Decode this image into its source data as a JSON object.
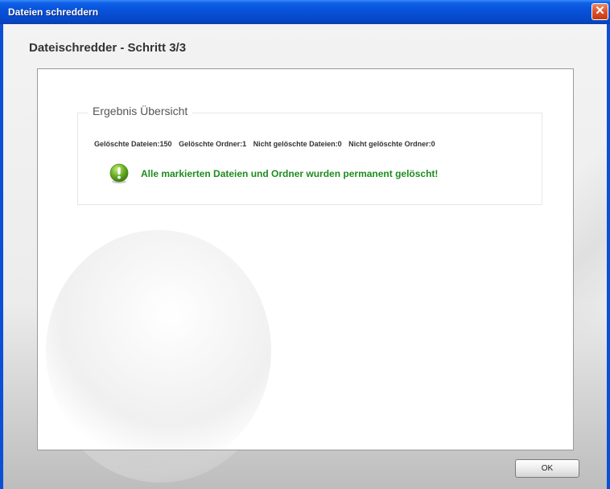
{
  "window": {
    "title": "Dateien schreddern"
  },
  "titlebar": {
    "close_glyph": "✕",
    "close_icon": "close-icon"
  },
  "page": {
    "title": "Dateischredder - Schritt 3/3"
  },
  "results": {
    "legend": "Ergebnis Übersicht",
    "stats": [
      "Gelöschte Dateien:150",
      "Gelöschte Ordner:1",
      "Nicht gelöschte Dateien:0",
      "Nicht gelöschte Ordner:0"
    ],
    "success_icon": "exclamation-circle-icon",
    "success_message": "Alle markierten Dateien und Ordner wurden permanent gelöscht!"
  },
  "buttons": {
    "ok_label": "OK"
  },
  "colors": {
    "titlebar_blue": "#0852db",
    "success_green": "#1e8c1e",
    "close_red": "#d9542c",
    "icon_green": "#6ab02a"
  }
}
